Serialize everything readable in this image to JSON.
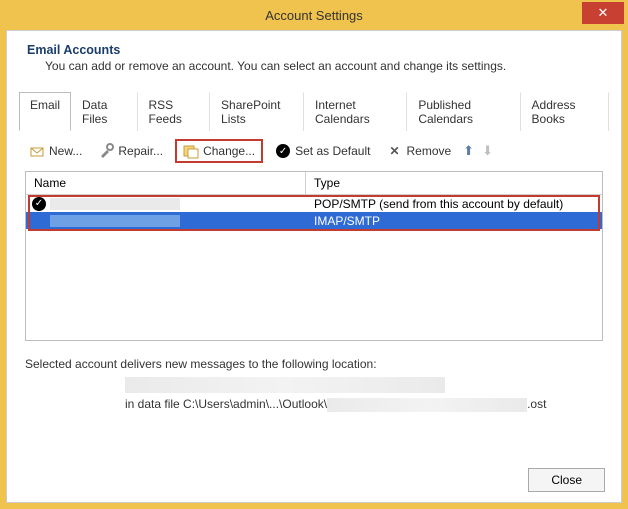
{
  "window": {
    "title": "Account Settings",
    "close_glyph": "✕"
  },
  "header": {
    "title": "Email Accounts",
    "description": "You can add or remove an account. You can select an account and change its settings."
  },
  "tabs": [
    {
      "label": "Email",
      "active": true
    },
    {
      "label": "Data Files"
    },
    {
      "label": "RSS Feeds"
    },
    {
      "label": "SharePoint Lists"
    },
    {
      "label": "Internet Calendars"
    },
    {
      "label": "Published Calendars"
    },
    {
      "label": "Address Books"
    }
  ],
  "toolbar": {
    "new_label": "New...",
    "repair_label": "Repair...",
    "change_label": "Change...",
    "default_label": "Set as Default",
    "remove_label": "Remove"
  },
  "columns": {
    "name": "Name",
    "type": "Type"
  },
  "accounts": [
    {
      "type_label": "POP/SMTP (send from this account by default)",
      "default": true,
      "selected": false
    },
    {
      "type_label": "IMAP/SMTP",
      "default": false,
      "selected": true
    }
  ],
  "info": {
    "label": "Selected account delivers new messages to the following location:",
    "path_prefix": "in data file C:\\Users\\admin\\...\\Outlook\\",
    "path_suffix": ".ost"
  },
  "footer": {
    "close_label": "Close"
  }
}
